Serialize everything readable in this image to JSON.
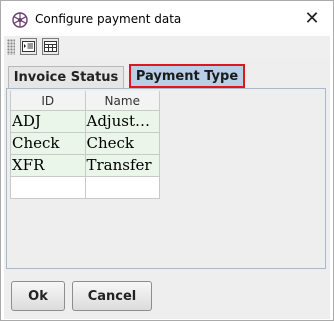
{
  "window": {
    "title": "Configure payment data",
    "close_glyph": "✕",
    "icon": "settings-wheel-icon"
  },
  "toolbar": {
    "buttons": [
      {
        "icon": "indent-list-icon"
      },
      {
        "icon": "table-layout-icon"
      }
    ]
  },
  "tabs": [
    {
      "label": "Invoice Status",
      "selected": false
    },
    {
      "label": "Payment Type",
      "selected": true
    }
  ],
  "table": {
    "columns": [
      "ID",
      "Name"
    ],
    "rows": [
      [
        "ADJ",
        "Adjust…"
      ],
      [
        "Check",
        "Check"
      ],
      [
        "XFR",
        "Transfer"
      ],
      [
        "",
        ""
      ]
    ]
  },
  "buttons": {
    "ok": "Ok",
    "cancel": "Cancel"
  },
  "colors": {
    "selected_tab": "#b8cfe5",
    "highlight_border": "#e0161c",
    "row_fill": "#e9f6e9"
  }
}
